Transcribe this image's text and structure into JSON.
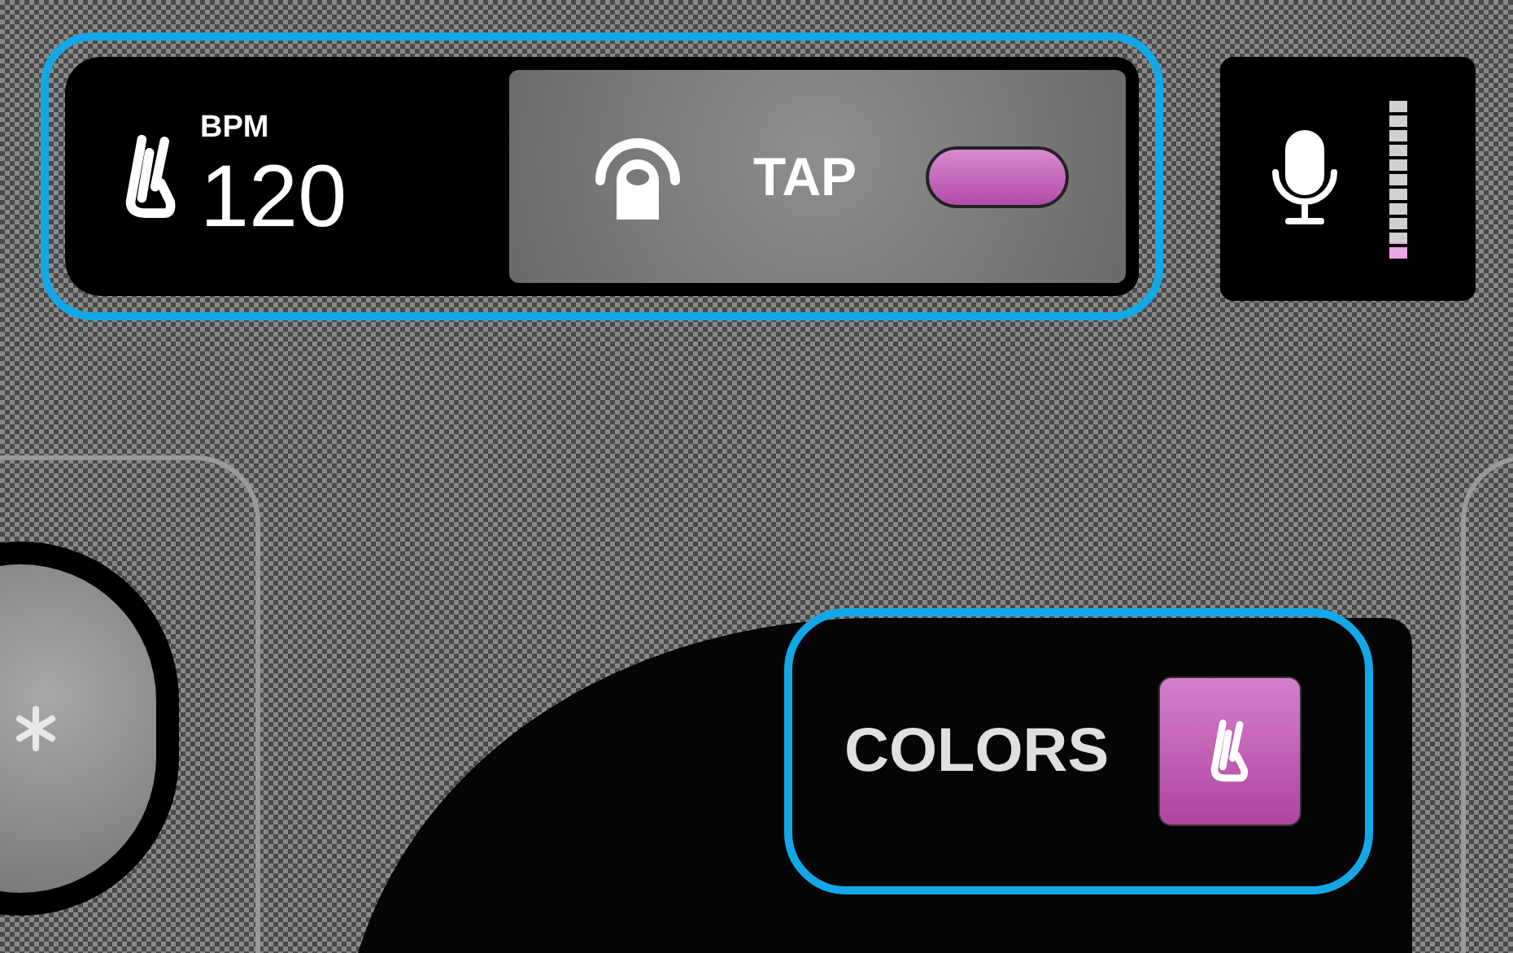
{
  "tempo": {
    "label": "BPM",
    "value": "120"
  },
  "tap": {
    "label": "TAP"
  },
  "mic": {
    "level": 0.1
  },
  "colors": {
    "label": "COLORS"
  }
}
